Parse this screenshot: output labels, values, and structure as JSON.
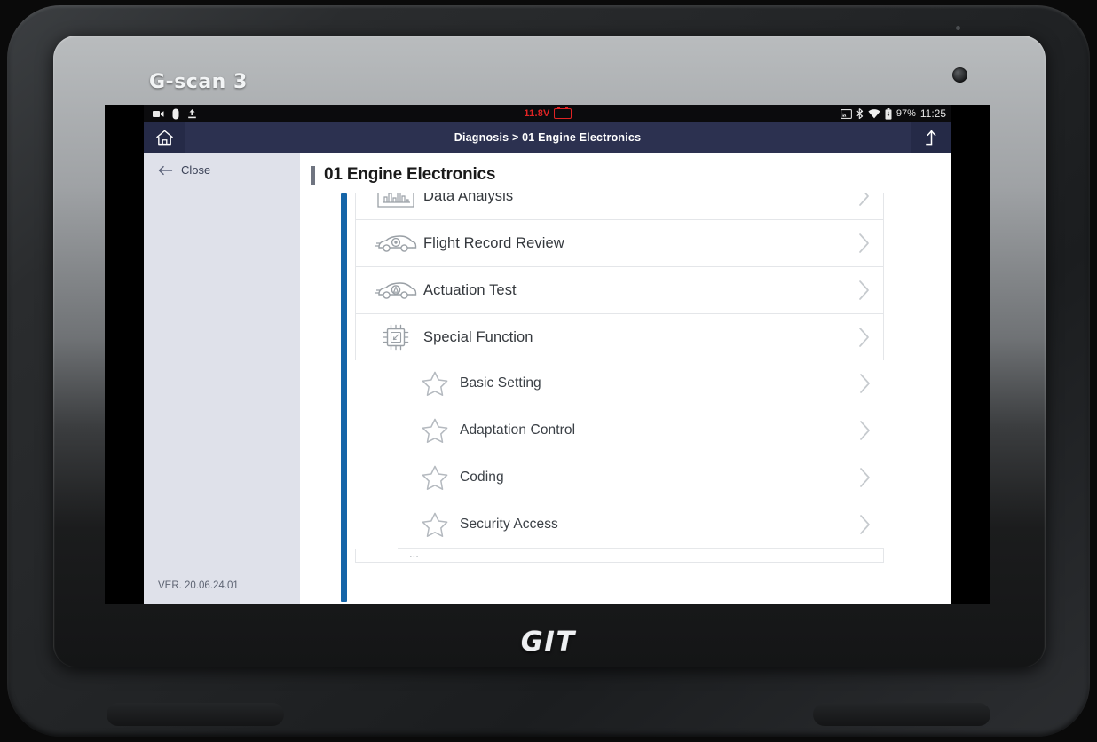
{
  "device": {
    "brand_top": "G-scan 3",
    "brand_bottom": "GIT"
  },
  "statusbar": {
    "left_icons": [
      "video-camera-icon",
      "capsule-icon",
      "upload-icon"
    ],
    "voltage": "11.8V",
    "voltage_color": "#e02424",
    "battery_icon": "car-battery-icon",
    "right_icons": [
      "screencast-icon",
      "bluetooth-icon",
      "wifi-icon",
      "battery-icon"
    ],
    "battery_percent": "97%",
    "clock": "11:25"
  },
  "appbar": {
    "home_icon": "home-icon",
    "breadcrumb": "Diagnosis > 01 Engine Electronics",
    "upload_icon": "upload-arrow-icon",
    "background": "#2c3150"
  },
  "sidebar": {
    "close_label": "Close",
    "back_icon": "arrow-left-icon",
    "version": "VER. 20.06.24.01"
  },
  "main": {
    "title": "01 Engine Electronics",
    "accent_color": "#1565a8",
    "items": [
      {
        "label": "Data Analysis",
        "icon": "waveform-chart-icon",
        "level": "top",
        "partial": true
      },
      {
        "label": "Flight Record Review",
        "icon": "car-record-icon",
        "level": "top",
        "partial": false
      },
      {
        "label": "Actuation Test",
        "icon": "car-actuation-icon",
        "level": "top",
        "partial": false
      },
      {
        "label": "Special Function",
        "icon": "chip-icon",
        "level": "top",
        "partial": false
      },
      {
        "label": "Basic Setting",
        "icon": "star-icon",
        "level": "sub",
        "partial": false
      },
      {
        "label": "Adaptation Control",
        "icon": "star-icon",
        "level": "sub",
        "partial": false
      },
      {
        "label": "Coding",
        "icon": "star-icon",
        "level": "sub",
        "partial": false
      },
      {
        "label": "Security Access",
        "icon": "star-icon",
        "level": "sub",
        "partial": false
      }
    ],
    "chevron_icon": "chevron-right-icon",
    "cut_off_row": "..."
  },
  "navbar": {
    "items": [
      {
        "icon": "back-triangle-icon"
      },
      {
        "icon": "home-square-icon"
      },
      {
        "icon": "apps-grid-icon"
      },
      {
        "icon": "globe-icon"
      },
      {
        "icon": "gear-icon"
      },
      {
        "icon": "screenshot-crop-icon"
      }
    ]
  }
}
